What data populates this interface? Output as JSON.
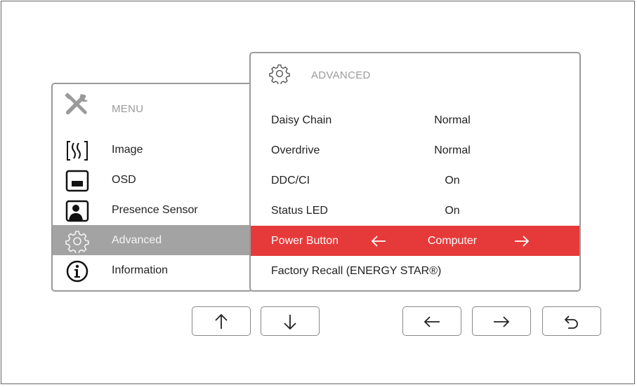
{
  "menu": {
    "title": "MENU",
    "items": [
      {
        "label": "Image",
        "icon": "image-icon"
      },
      {
        "label": "OSD",
        "icon": "osd-icon"
      },
      {
        "label": "Presence Sensor",
        "icon": "presence-sensor-icon"
      },
      {
        "label": "Advanced",
        "icon": "gear-icon",
        "active": true
      },
      {
        "label": "Information",
        "icon": "info-icon"
      }
    ]
  },
  "advanced": {
    "title": "ADVANCED",
    "rows": [
      {
        "label": "Daisy Chain",
        "value": "Normal"
      },
      {
        "label": "Overdrive",
        "value": "Normal"
      },
      {
        "label": "DDC/CI",
        "value": "On"
      },
      {
        "label": "Status LED",
        "value": "On"
      },
      {
        "label": "Power Button",
        "value": "Computer",
        "selected": true
      },
      {
        "label": "Factory Recall (ENERGY STAR®)",
        "value": ""
      }
    ]
  },
  "colors": {
    "highlight": "#e63a3a",
    "active_menu": "#a3a3a3",
    "muted_text": "#9a9a9a"
  },
  "nav_buttons": [
    "up-arrow-icon",
    "down-arrow-icon",
    "left-arrow-icon",
    "right-arrow-icon",
    "back-icon"
  ]
}
